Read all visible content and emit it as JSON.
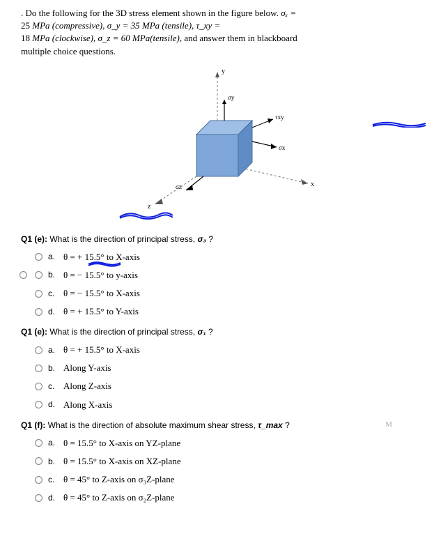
{
  "intro": {
    "l1_a": ".    Do the following for the 3D stress element shown in the figure below. ",
    "l1_b": "σₓ =",
    "l2_a": "25 ",
    "l2_b": "MPa (compressive), σ_y = 35 MPa (tensile), τ_xy =",
    "l3_a": "18 ",
    "l3_b": "MPa (clockwise), σ_z = 60 MPa(tensile),",
    "l3_c": "  and  answer  them  in  blackboard",
    "l4": "multiple choice questions."
  },
  "fig": {
    "y": "y",
    "x": "x",
    "z": "z",
    "sigy": "σy",
    "sigx": "σx",
    "sigz": "σz",
    "txy": "τxy"
  },
  "q1": {
    "num": "Q1 (e):",
    "text": " What is the direction of principal stress, ",
    "sym": "σ₃",
    "qm": " ?",
    "opts": {
      "a": {
        "l": "a.",
        "t": "θ = + 15.5°  to X-axis"
      },
      "b": {
        "l": "b.",
        "t": "θ = − 15.5°  to y-axis"
      },
      "c": {
        "l": "c.",
        "t": "θ = − 15.5°   to X-axis"
      },
      "d": {
        "l": "d.",
        "t": "θ = + 15.5°  to Y-axis"
      }
    }
  },
  "q2": {
    "num": "Q1 (e):",
    "text": " What is the direction of principal stress, ",
    "sym": "σ₁",
    "qm": " ?",
    "opts": {
      "a": {
        "l": "a.",
        "t": "θ = + 15.5°  to X-axis"
      },
      "b": {
        "l": "b.",
        "t": "Along Y-axis"
      },
      "c": {
        "l": "c.",
        "t": "Along Z-axis"
      },
      "d": {
        "l": "d.",
        "t": "Along X-axis"
      }
    }
  },
  "q3": {
    "num": "Q1 (f):",
    "text": " What is the direction of absolute maximum shear stress, ",
    "sym": "τ_max",
    "qm": " ?",
    "mark": "M",
    "opts": {
      "a": {
        "l": "a.",
        "t": "θ = 15.5°  to X-axis on YZ-plane"
      },
      "b": {
        "l": "b.",
        "t": "θ = 15.5°  to X-axis on XZ-plane"
      },
      "c": {
        "l": "c.",
        "t": "θ = 45°   to Z-axis on σ₃Z-plane"
      },
      "d": {
        "l": "d.",
        "t": "θ = 45°   to Z-axis on σ₂Z-plane"
      }
    }
  }
}
